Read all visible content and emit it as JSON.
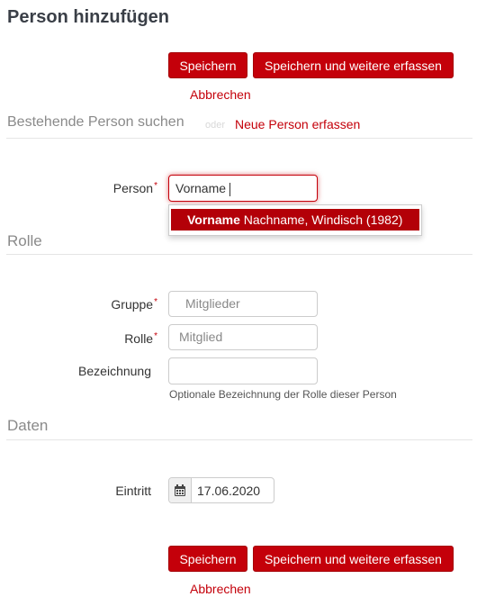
{
  "page": {
    "title": "Person hinzufügen"
  },
  "actions_top": {
    "save": "Speichern",
    "save_more": "Speichern und weitere erfassen",
    "cancel": "Abbrechen"
  },
  "search_section": {
    "title": "Bestehende Person suchen",
    "or": "oder",
    "new_person_link": "Neue Person erfassen"
  },
  "person_field": {
    "label": "Person",
    "value": "Vorname ",
    "suggestion_bold": "Vorname",
    "suggestion_rest": " Nachname, Windisch (1982)"
  },
  "role_section": {
    "title": "Rolle"
  },
  "group_field": {
    "label": "Gruppe",
    "value": "Mitglieder"
  },
  "role_field": {
    "label": "Rolle",
    "value": "Mitglied"
  },
  "designation_field": {
    "label": "Bezeichnung",
    "value": "",
    "help": "Optionale Bezeichnung der Rolle dieser Person"
  },
  "data_section": {
    "title": "Daten"
  },
  "entry_field": {
    "label": "Eintritt",
    "value": "17.06.2020",
    "icon": "calendar-icon"
  },
  "actions_bottom": {
    "save": "Speichern",
    "save_more": "Speichern und weitere erfassen",
    "cancel": "Abbrechen"
  },
  "colors": {
    "accent": "#c4000a",
    "section": "#8a8a8a"
  }
}
